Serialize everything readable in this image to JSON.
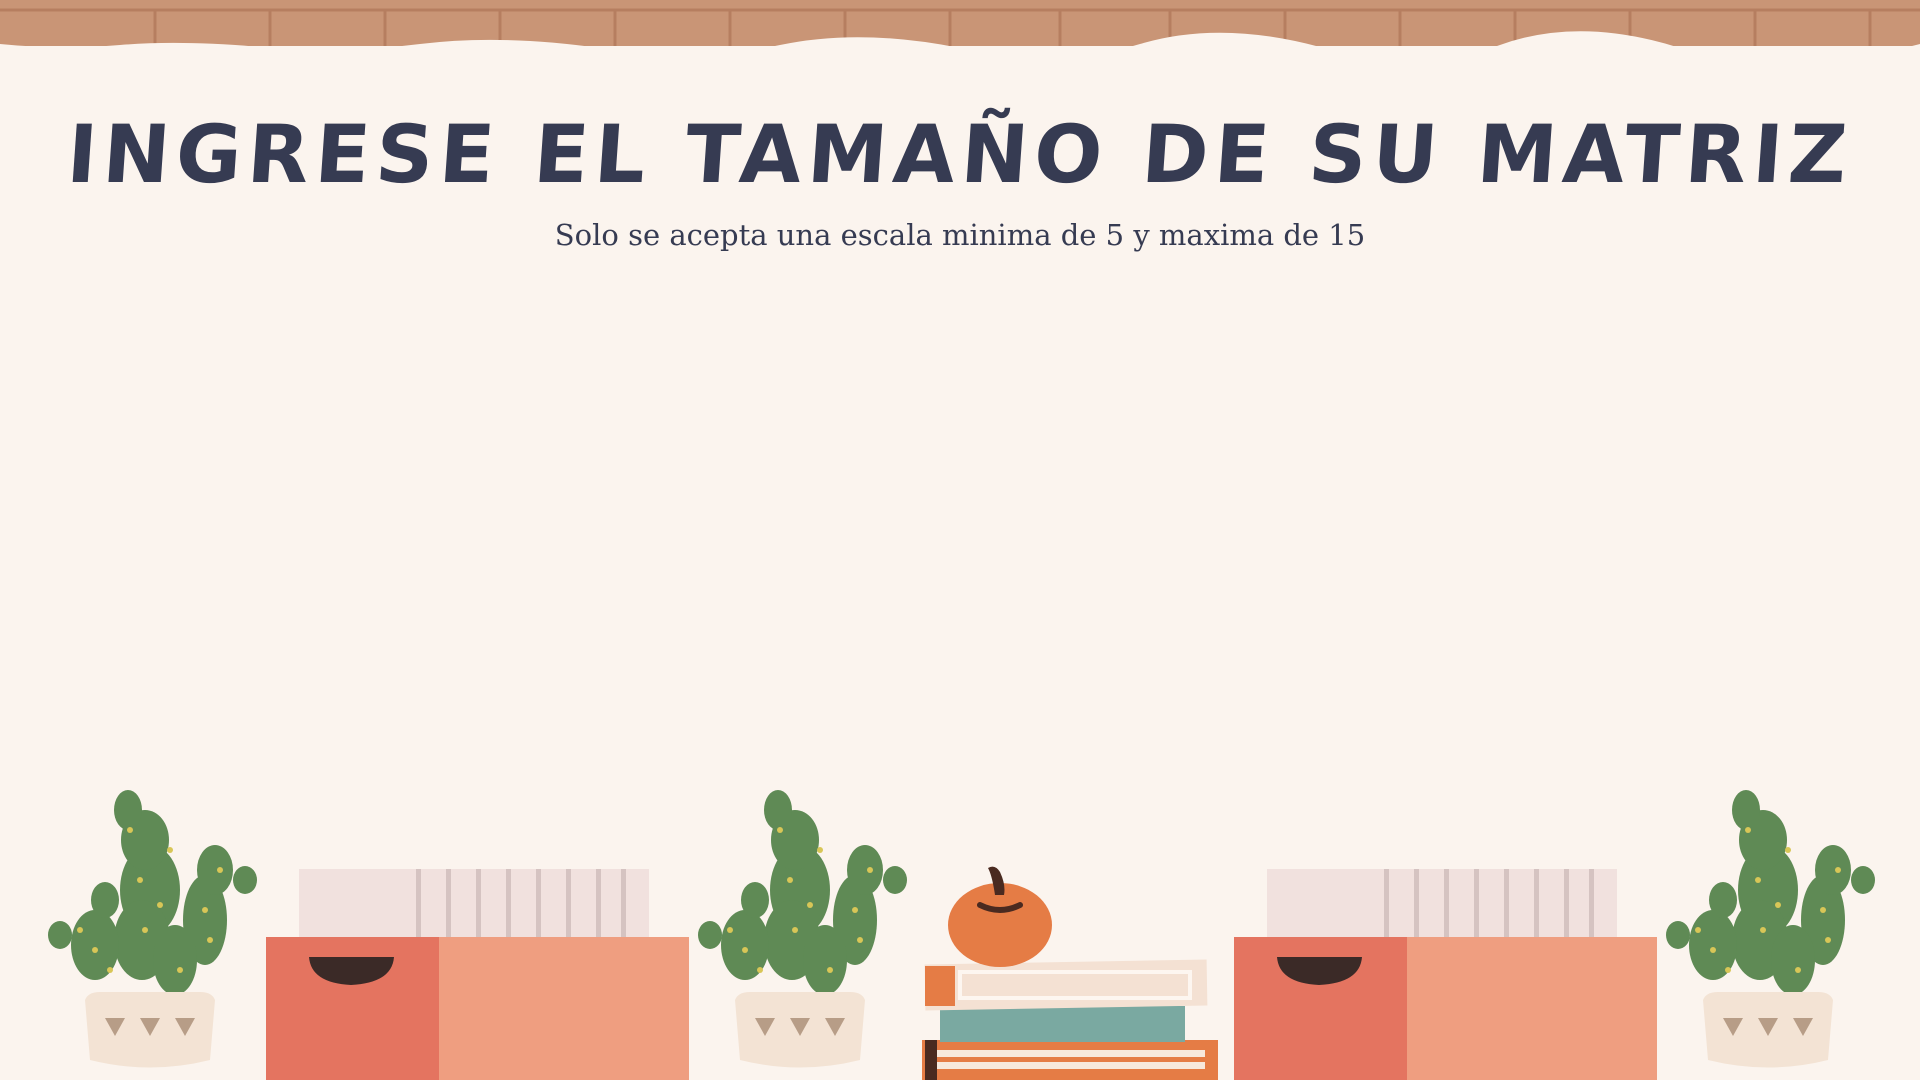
{
  "screen": {
    "title": "INGRESE EL TAMAÑO DE SU MATRIZ",
    "subtitle": "Solo se acepta una escala minima de 5 y maxima de 15"
  },
  "colors": {
    "background": "#fbf4ee",
    "brick": "#c99576",
    "text": "#363b52",
    "cactus": "#5f8a55",
    "box_dark": "#e47460",
    "box_light": "#ef9e80",
    "pumpkin": "#e57c45",
    "book_teal": "#7aa9a1"
  },
  "icons": [
    "brick-wall",
    "cactus-plant",
    "storage-box",
    "pumpkin",
    "book-stack"
  ]
}
